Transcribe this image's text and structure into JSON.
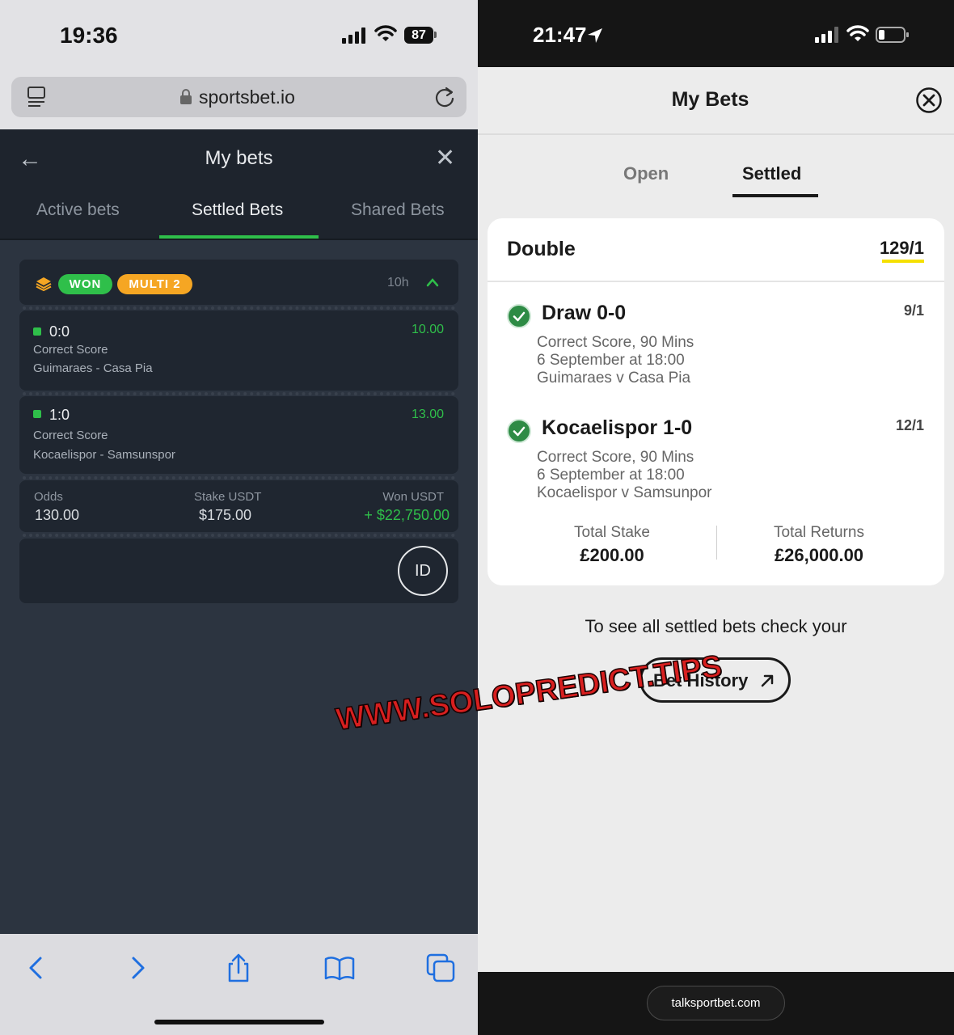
{
  "left": {
    "status_bar": {
      "time": "19:36",
      "battery": "87"
    },
    "url_bar": {
      "domain": "sportsbet.io"
    },
    "header": {
      "title": "My bets"
    },
    "tabs": [
      {
        "label": "Active bets",
        "active": false
      },
      {
        "label": "Settled Bets",
        "active": true
      },
      {
        "label": "Shared Bets",
        "active": false
      }
    ],
    "bet": {
      "status_badge": "WON",
      "type_badge": "MULTI 2",
      "time_ago": "10h",
      "selections": [
        {
          "score": "0:0",
          "market": "Correct Score",
          "event": "Guimaraes - Casa Pia",
          "odds": "10.00"
        },
        {
          "score": "1:0",
          "market": "Correct Score",
          "event": "Kocaelispor - Samsunspor",
          "odds": "13.00"
        }
      ],
      "summary": {
        "odds_label": "Odds",
        "odds_value": "130.00",
        "stake_label": "Stake USDT",
        "stake_value": "$175.00",
        "won_label": "Won USDT",
        "won_value": "+ $22,750.00"
      },
      "id_button": "ID"
    }
  },
  "right": {
    "status_bar": {
      "time": "21:47"
    },
    "header": {
      "title": "My Bets"
    },
    "tabs": [
      {
        "label": "Open",
        "active": false
      },
      {
        "label": "Settled",
        "active": true
      }
    ],
    "card": {
      "title": "Double",
      "odds": "129/1",
      "selections": [
        {
          "title": "Draw 0-0",
          "odds": "9/1",
          "market": "Correct Score, 90 Mins",
          "date": "6 September at 18:00",
          "event": "Guimaraes v Casa Pia"
        },
        {
          "title": "Kocaelispor 1-0",
          "odds": "12/1",
          "market": "Correct Score, 90 Mins",
          "date": "6 September at 18:00",
          "event": "Kocaelispor v Samsunpor"
        }
      ],
      "total_stake_label": "Total Stake",
      "total_stake_value": "£200.00",
      "total_returns_label": "Total Returns",
      "total_returns_value": "£26,000.00"
    },
    "info_text": "To see all settled bets check your",
    "history_button": "Bet History",
    "bottom_domain": "talksportbet.com"
  },
  "watermark": "WWW.SOLOPREDICT.TIPS",
  "colors": {
    "left_bg": "#2c3440",
    "left_card": "#1f2630",
    "accent_green": "#2fbf4a",
    "badge_orange": "#f5a623",
    "right_bg": "#ececec",
    "underline_yellow": "#f5e000",
    "check_green": "#2e8b45",
    "watermark_red": "#d81f1f"
  }
}
